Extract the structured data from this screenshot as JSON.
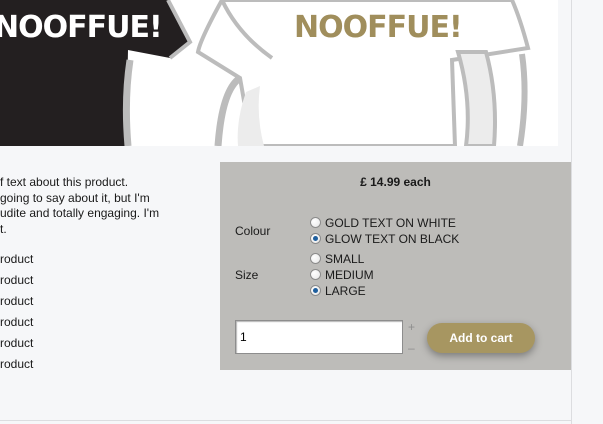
{
  "hero": {
    "brand_left": "NOOFFUE!",
    "brand_right": "NOOFFUE!"
  },
  "product": {
    "description": [
      "f text about this product.",
      "going to say about it, but I'm",
      "udite and totally engaging. I'm",
      "t."
    ],
    "features": [
      "roduct",
      "roduct",
      "roduct",
      "roduct",
      "roduct",
      "roduct"
    ]
  },
  "purchase": {
    "price": "£ 14.99 each",
    "colour_label": "Colour",
    "colour_options": [
      {
        "label": "GOLD TEXT ON WHITE",
        "checked": false
      },
      {
        "label": "GLOW TEXT ON BLACK",
        "checked": true
      }
    ],
    "size_label": "Size",
    "size_options": [
      {
        "label": "SMALL",
        "checked": false
      },
      {
        "label": "MEDIUM",
        "checked": false
      },
      {
        "label": "LARGE",
        "checked": true
      }
    ],
    "quantity": "1",
    "increase": "+",
    "decrease": "–",
    "add_button": "Add to cart"
  },
  "colors": {
    "panel": "#bdbcb9",
    "gold_button": "#a79661",
    "brand_gold": "#a08e5c",
    "background": "#f6f7f9"
  }
}
